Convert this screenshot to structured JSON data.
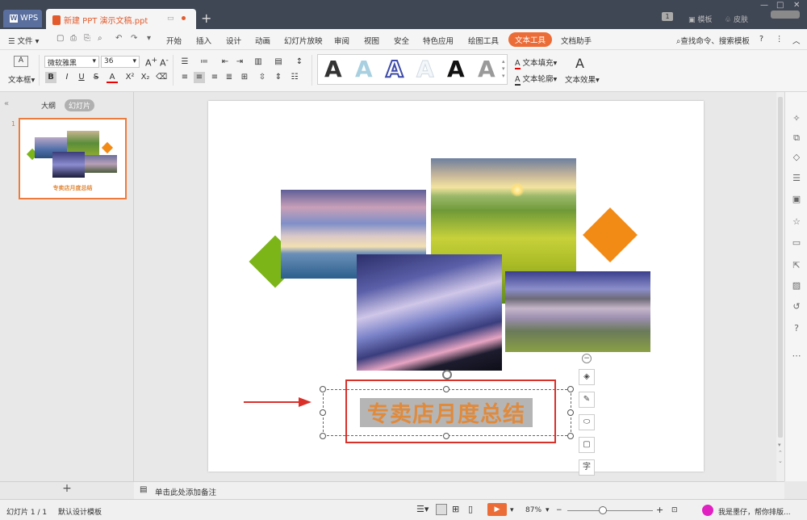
{
  "window": {
    "app_tab": "WPS",
    "doc_tab": "新建 PPT 演示文稿.ppt",
    "badge": "1",
    "template_label": "模板",
    "skin_label": "皮肤"
  },
  "menu": {
    "file": "文件",
    "items": [
      "开始",
      "插入",
      "设计",
      "动画",
      "幻灯片放映",
      "审阅",
      "视图",
      "安全",
      "特色应用",
      "绘图工具",
      "文本工具",
      "文档助手"
    ],
    "active": "文本工具",
    "search": "查找命令、搜索模板",
    "help": "?"
  },
  "ribbon": {
    "textbox_label": "文本框",
    "font_name": "微软雅黑",
    "font_size": "36",
    "text_fill": "文本填充",
    "text_outline": "文本轮廓",
    "text_effect": "文本效果",
    "style_colors": [
      "#222222",
      "#a8d0e0",
      "#3d4aa8",
      "#e0e8ee",
      "#111111",
      "#9a9a9a"
    ]
  },
  "left_panel": {
    "tab_outline": "大纲",
    "tab_slides": "幻灯片",
    "slide_number": "1",
    "thumb_title": "专卖店月度总结"
  },
  "slide": {
    "title": "专卖店月度总结"
  },
  "notes": {
    "placeholder": "单击此处添加备注"
  },
  "status": {
    "slide_info": "幻灯片 1 / 1",
    "template": "默认设计模板",
    "zoom": "87%",
    "assistant": "我是墨仔，帮你排版..."
  },
  "colors": {
    "accent": "#ec6c38",
    "title_text": "#e08a3c",
    "green_diamond": "#7cb518",
    "orange_diamond": "#f28a16",
    "red_frame": "#d9302a"
  }
}
